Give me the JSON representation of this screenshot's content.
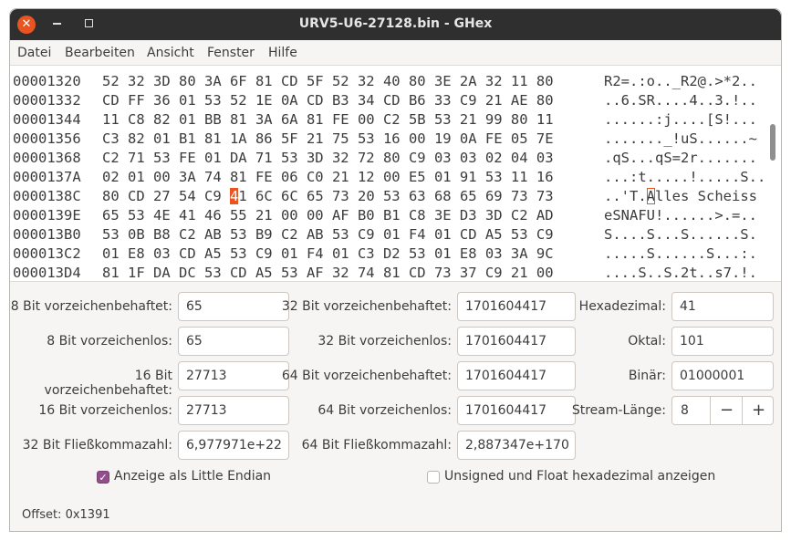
{
  "window": {
    "title": "URV5-U6-27128.bin - GHex",
    "close_glyph": "✕"
  },
  "menu": [
    "Datei",
    "Bearbeiten",
    "Ansicht",
    "Fenster",
    "Hilfe"
  ],
  "hex_rows": [
    {
      "offset": "00001320",
      "hex": "52 32 3D 80 3A 6F 81 CD 5F 52 32 40 80 3E 2A 32 11 80",
      "ascii": "R2=.:o.._R2@.>*2.."
    },
    {
      "offset": "00001332",
      "hex": "CD FF 36 01 53 52 1E 0A CD B3 34 CD B6 33 C9 21 AE 80",
      "ascii": "..6.SR....4..3.!.."
    },
    {
      "offset": "00001344",
      "hex": "11 C8 82 01 BB 81 3A 6A 81 FE 00 C2 5B 53 21 99 80 11",
      "ascii": "......:j....[S!..."
    },
    {
      "offset": "00001356",
      "hex": "C3 82 01 B1 81 1A 86 5F 21 75 53 16 00 19 0A FE 05 7E",
      "ascii": "......._!uS......~"
    },
    {
      "offset": "00001368",
      "hex": "C2 71 53 FE 01 DA 71 53 3D 32 72 80 C9 03 03 02 04 03",
      "ascii": ".qS...qS=2r......."
    },
    {
      "offset": "0000137A",
      "hex": "02 01 00 3A 74 81 FE 06 C0 21 12 00 E5 01 91 53 11 16",
      "ascii": "...:t.....!.....S.."
    },
    {
      "offset": "0000138C",
      "hex_pre": "80 CD 27 54 C9 ",
      "hex_sel_a": "4",
      "hex_sel_b": "1",
      "hex_post": " 6C 6C 65 73 20 53 63 68 65 69 73 73",
      "ascii_pre": "..'T.",
      "ascii_sel": "A",
      "ascii_post": "lles Scheiss"
    },
    {
      "offset": "0000139E",
      "hex": "65 53 4E 41 46 55 21 00 00 AF B0 B1 C8 3E D3 3D C2 AD",
      "ascii": "eSNAFU!......>.=.."
    },
    {
      "offset": "000013B0",
      "hex": "53 0B B8 C2 AB 53 B9 C2 AB 53 C9 01 F4 01 CD A5 53 C9",
      "ascii": "S....S...S......S."
    },
    {
      "offset": "000013C2",
      "hex": "01 E8 03 CD A5 53 C9 01 F4 01 C3 D2 53 01 E8 03 3A 9C",
      "ascii": ".....S......S...:."
    },
    {
      "offset": "000013D4",
      "hex": "81 1F DA DC 53 CD A5 53 AF 32 74 81 CD 73 37 C9 21 00",
      "ascii": "....S..S.2t..s7.!."
    }
  ],
  "fields": {
    "col1": [
      {
        "label": "8 Bit vorzeichenbehaftet:",
        "value": "65"
      },
      {
        "label": "8 Bit vorzeichenlos:",
        "value": "65"
      },
      {
        "label": "16 Bit vorzeichenbehaftet:",
        "value": "27713"
      },
      {
        "label": "16 Bit vorzeichenlos:",
        "value": "27713"
      },
      {
        "label": "32 Bit Fließkommazahl:",
        "value": "6,977971e+22"
      }
    ],
    "col2": [
      {
        "label": "32 Bit vorzeichenbehaftet:",
        "value": "1701604417"
      },
      {
        "label": "32 Bit vorzeichenlos:",
        "value": "1701604417"
      },
      {
        "label": "64 Bit vorzeichenbehaftet:",
        "value": "1701604417"
      },
      {
        "label": "64 Bit vorzeichenlos:",
        "value": "1701604417"
      },
      {
        "label": "64 Bit Fließkommazahl:",
        "value": "2,887347e+170"
      }
    ],
    "col3": [
      {
        "label": "Hexadezimal:",
        "value": "41"
      },
      {
        "label": "Oktal:",
        "value": "101"
      },
      {
        "label": "Binär:",
        "value": "01000001"
      }
    ],
    "stream": {
      "label": "Stream-Länge:",
      "value": "8",
      "minus": "−",
      "plus": "+"
    }
  },
  "options": {
    "little_endian": {
      "label": "Anzeige als Little Endian",
      "checked": true
    },
    "unsigned_hex": {
      "label": "Unsigned und Float hexadezimal anzeigen",
      "checked": false
    }
  },
  "status": {
    "offset": "Offset: 0x1391"
  },
  "colors": {
    "accent": "#e95420",
    "check": "#924d8b",
    "titlebar": "#2f2f2f"
  }
}
